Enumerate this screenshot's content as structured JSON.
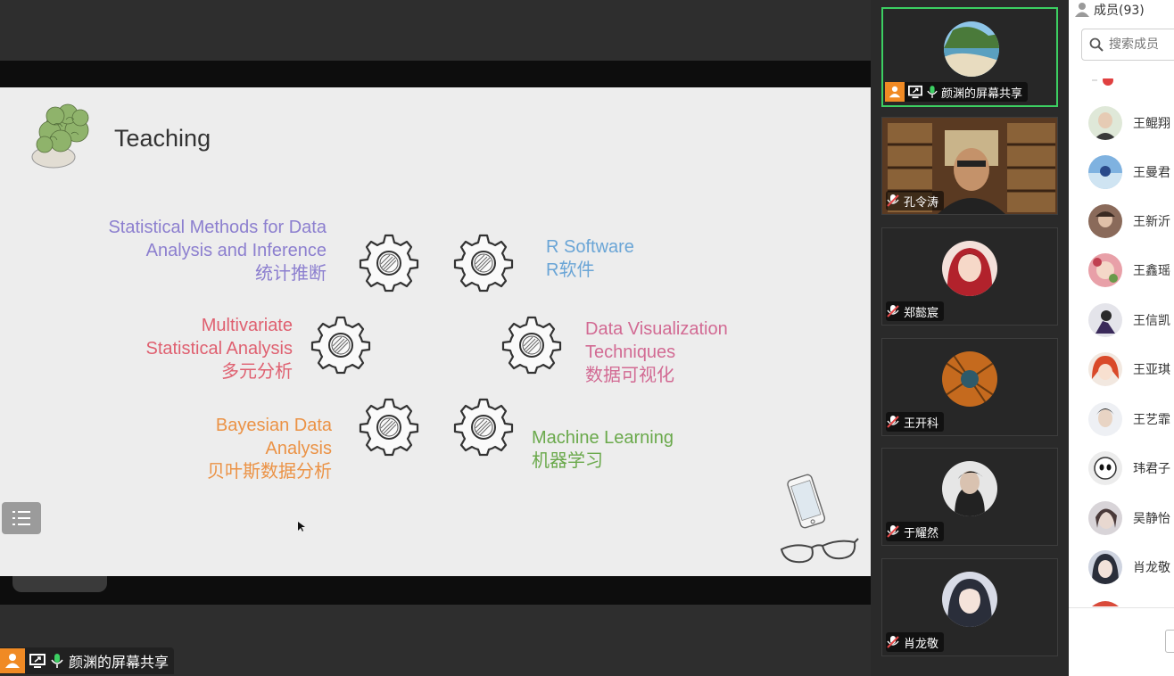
{
  "share": {
    "presenter_label": "颜渊的屏幕共享"
  },
  "slide": {
    "title": "Teaching",
    "topics": {
      "stats_methods": [
        "Statistical Methods for Data",
        "Analysis and Inference",
        "统计推断"
      ],
      "r_software": [
        "R Software",
        "R软件"
      ],
      "multivariate": [
        "Multivariate",
        "Statistical Analysis",
        "多元分析"
      ],
      "data_vis": [
        "Data Visualization",
        "Techniques",
        "数据可视化"
      ],
      "bayesian": [
        "Bayesian Data",
        "Analysis",
        "贝叶斯数据分析"
      ],
      "machine_learning": [
        "Machine Learning",
        "机器学习"
      ]
    },
    "colors": {
      "purple": "#8c7fcf",
      "blue": "#6aa5d6",
      "red": "#df6070",
      "pink": "#d26a93",
      "orange": "#eb9245",
      "green": "#6aa94b"
    }
  },
  "video_tiles": [
    {
      "name": "颜渊的屏幕共享",
      "icon": "presenter-icons",
      "active": true
    },
    {
      "name": "孔令涛",
      "icon": "mic-muted-icon"
    },
    {
      "name": "郑懿宸",
      "icon": "mic-muted-icon"
    },
    {
      "name": "王开科",
      "icon": "mic-muted-icon"
    },
    {
      "name": "于耀然",
      "icon": "mic-muted-icon"
    },
    {
      "name": "肖龙敬",
      "icon": "mic-muted-icon"
    }
  ],
  "members": {
    "title": "成员(93)",
    "search_placeholder": "搜索成员",
    "list": [
      "王鲲翔",
      "王曼君",
      "王新沂",
      "王鑫瑶",
      "王信凯",
      "王亚琪",
      "王艺霏",
      "玮君子",
      "吴静怡",
      "肖龙敬"
    ]
  },
  "accent_colors": {
    "active_border": "#3ccf62",
    "presenter_badge": "#f08a24"
  }
}
